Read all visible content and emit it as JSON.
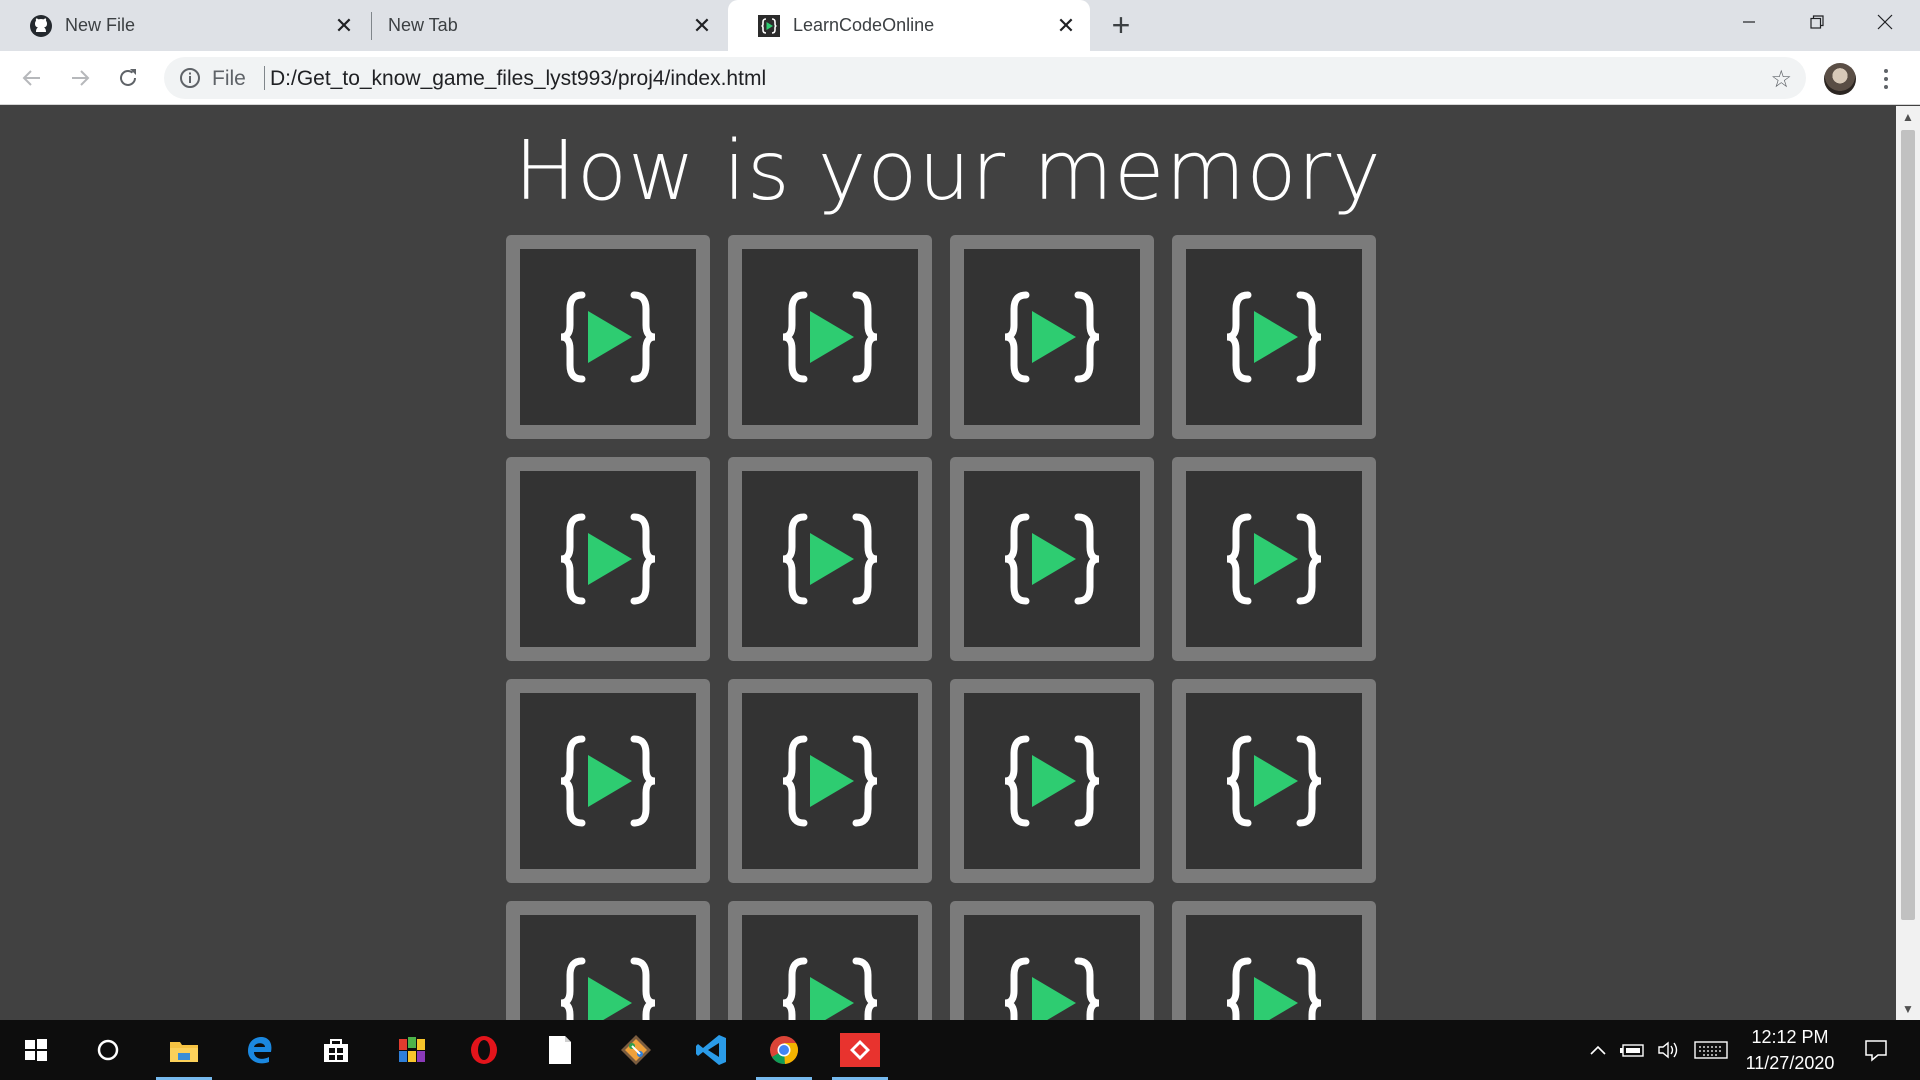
{
  "browser": {
    "tabs": [
      {
        "title": "New File",
        "icon": "github-icon",
        "active": false
      },
      {
        "title": "New Tab",
        "icon": "",
        "active": false
      },
      {
        "title": "LearnCodeOnline",
        "icon": "learncodeonline-icon",
        "active": true
      }
    ],
    "address": {
      "security_chip": "File",
      "url": "D:/Get_to_know_game_files_lyst993/proj4/index.html"
    }
  },
  "page": {
    "title": "How is your memory",
    "card_rows_visible": 4,
    "card_columns": 4,
    "card_face_icon": "learncodeonline-logo-icon",
    "colors": {
      "background": "#414141",
      "card_border": "#7b7b7b",
      "card_face": "#333333",
      "logo_green": "#2ecc71",
      "logo_braces": "#ffffff"
    }
  },
  "taskbar": {
    "apps": [
      "start-icon",
      "search-icon",
      "file-explorer-icon",
      "edge-icon",
      "store-icon",
      "app-icon",
      "opera-icon",
      "notepad-icon",
      "git-icon",
      "vscode-icon",
      "chrome-icon",
      "git-client-icon"
    ],
    "time": "12:12 PM",
    "date": "11/27/2020"
  }
}
